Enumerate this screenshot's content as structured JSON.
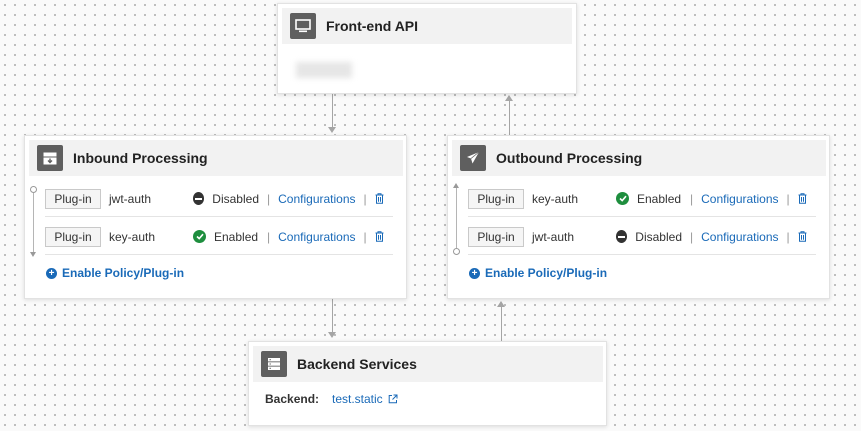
{
  "frontend": {
    "title": "Front-end API",
    "icon": "monitor-icon"
  },
  "inbound": {
    "title": "Inbound Processing",
    "icon": "inbox-download-icon",
    "rows": [
      {
        "pill": "Plug-in",
        "name": "jwt-auth",
        "status": "Disabled",
        "config": "Configurations"
      },
      {
        "pill": "Plug-in",
        "name": "key-auth",
        "status": "Enabled",
        "config": "Configurations"
      }
    ],
    "add_label": "Enable Policy/Plug-in"
  },
  "outbound": {
    "title": "Outbound Processing",
    "icon": "paper-plane-icon",
    "rows": [
      {
        "pill": "Plug-in",
        "name": "key-auth",
        "status": "Enabled",
        "config": "Configurations"
      },
      {
        "pill": "Plug-in",
        "name": "jwt-auth",
        "status": "Disabled",
        "config": "Configurations"
      }
    ],
    "add_label": "Enable Policy/Plug-in"
  },
  "backend": {
    "title": "Backend Services",
    "icon": "server-icon",
    "label": "Backend:",
    "value": "test.static"
  },
  "separator": "|",
  "colors": {
    "link": "#1a6ab8",
    "enabled": "#1e8e3e",
    "disabled": "#333333",
    "header_icon_bg": "#5f5f5f"
  }
}
